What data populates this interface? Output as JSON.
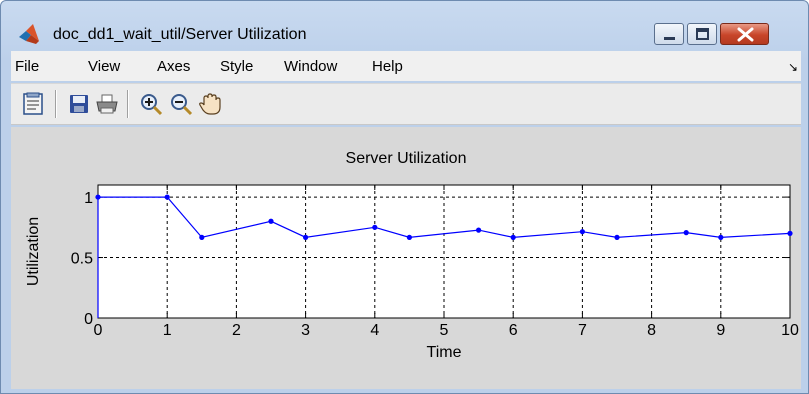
{
  "window": {
    "title": "doc_dd1_wait_util/Server Utilization",
    "icon": "matlab-icon"
  },
  "menu": {
    "items": [
      "File",
      "View",
      "Axes",
      "Style",
      "Window",
      "Help"
    ],
    "overflow_icon": "chevron-double-down-icon"
  },
  "toolbar": {
    "tools": [
      "properties-icon",
      "save-icon",
      "print-icon",
      "zoom-in-icon",
      "zoom-out-icon",
      "pan-hand-icon"
    ]
  },
  "chart_data": {
    "type": "line",
    "title": "Server Utilization",
    "xlabel": "Time",
    "ylabel": "Utilization",
    "xlim": [
      0,
      10
    ],
    "ylim": [
      0,
      1.1
    ],
    "xticks": [
      "0",
      "1",
      "2",
      "3",
      "4",
      "5",
      "6",
      "7",
      "8",
      "9",
      "10"
    ],
    "yticks": [
      "0",
      "0.5",
      "1"
    ],
    "grid": true,
    "series": [
      {
        "color": "#0000ff",
        "x": [
          0,
          0,
          1,
          1.5,
          2.5,
          3,
          4,
          4.5,
          5.5,
          6,
          7,
          7.5,
          8.5,
          9,
          10
        ],
        "y": [
          0,
          1,
          1,
          0.667,
          0.8,
          0.667,
          0.75,
          0.667,
          0.727,
          0.667,
          0.714,
          0.667,
          0.706,
          0.667,
          0.7
        ],
        "markers": [
          [
            0,
            1
          ],
          [
            1,
            1
          ],
          [
            1.5,
            0.667
          ],
          [
            2.5,
            0.8
          ],
          [
            3,
            0.667
          ],
          [
            4,
            0.75
          ],
          [
            4.5,
            0.667
          ],
          [
            5.5,
            0.727
          ],
          [
            6,
            0.667
          ],
          [
            7,
            0.714
          ],
          [
            7.5,
            0.667
          ],
          [
            8.5,
            0.706
          ],
          [
            9,
            0.667
          ],
          [
            10,
            0.7
          ]
        ]
      }
    ]
  }
}
